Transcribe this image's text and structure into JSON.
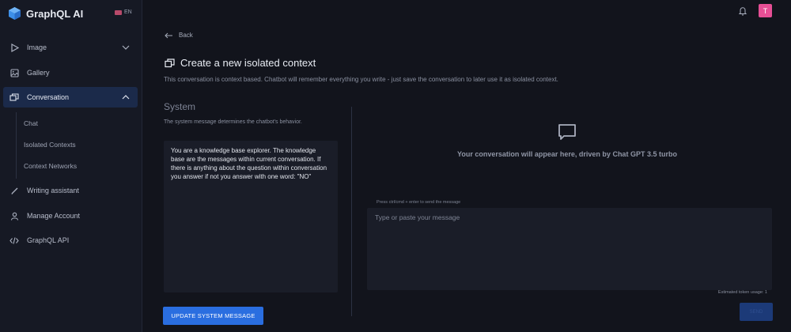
{
  "brand": {
    "name": "GraphQL AI",
    "lang": "EN"
  },
  "user": {
    "avatar_letter": "T"
  },
  "sidebar": {
    "items": [
      {
        "label": "Image",
        "icon": "play-icon"
      },
      {
        "label": "Gallery",
        "icon": "gallery-icon"
      },
      {
        "label": "Conversation",
        "icon": "conversation-icon"
      },
      {
        "label": "Writing assistant",
        "icon": "pen-icon"
      },
      {
        "label": "Manage Account",
        "icon": "user-icon"
      },
      {
        "label": "GraphQL API",
        "icon": "code-icon"
      }
    ],
    "sub_items": [
      {
        "label": "Chat"
      },
      {
        "label": "Isolated Contexts"
      },
      {
        "label": "Context Networks"
      }
    ]
  },
  "main": {
    "back_label": "Back",
    "title": "Create a new isolated context",
    "subtitle": "This conversation is context based. Chatbot will remember everything you write - just save the conversation to later use it as isolated context.",
    "system": {
      "heading": "System",
      "description": "The system message determines the chatbot's behavior.",
      "message": "You are a knowledge base explorer. The knowledge base are the messages within current conversation. If there is anything about the question within conversation you answer if not you answer with one word: \"NO\"",
      "update_button": "UPDATE SYSTEM MESSAGE"
    },
    "chat": {
      "placeholder_text": "Your conversation will appear here, driven by Chat GPT 3.5 turbo",
      "hint": "Press ctrl/cmd + enter to send the message",
      "input_placeholder": "Type or paste your message",
      "token_usage": "Estimated token usage: 1",
      "send_button": "SEND"
    }
  },
  "colors": {
    "background": "#12141c",
    "sidebar": "#161924",
    "accent": "#2a6ee0",
    "active_nav": "#1b2a4a",
    "avatar": "#e64f95"
  }
}
